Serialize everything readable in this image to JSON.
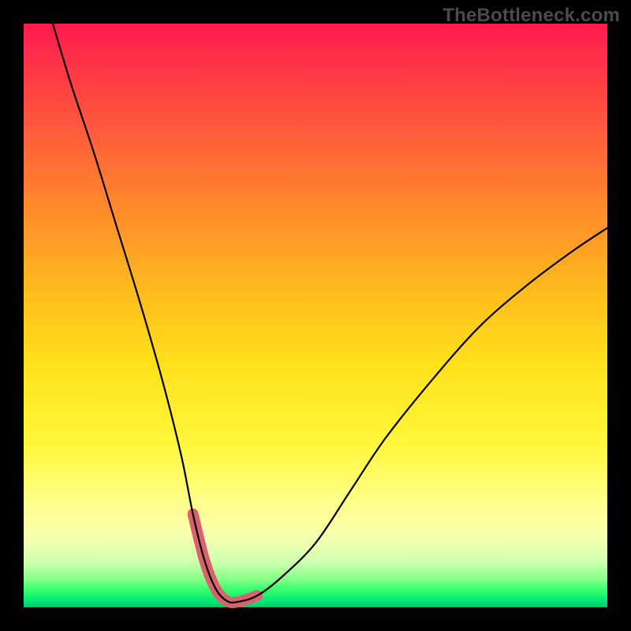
{
  "watermark": "TheBottleneck.com",
  "colors": {
    "frame_bg": "#000000",
    "gradient_top": "#ff1a4d",
    "gradient_bottom": "#00c866",
    "curve_stroke": "#000000",
    "highlight_stroke": "#d8626e"
  },
  "chart_data": {
    "type": "line",
    "title": "",
    "xlabel": "",
    "ylabel": "",
    "xlim": [
      0,
      100
    ],
    "ylim": [
      0,
      100
    ],
    "grid": false,
    "note": "Bottleneck curve: y axis is bottleneck percentage (0 at bottom / green, 100 at top / red); x axis is relative component balance. Values estimated from pixel positions; no numeric tick labels are rendered in the image.",
    "series": [
      {
        "name": "bottleneck_curve",
        "x": [
          5,
          8,
          12,
          16,
          20,
          24,
          27,
          29,
          31,
          33,
          35,
          37,
          40,
          44,
          50,
          56,
          62,
          70,
          78,
          86,
          94,
          100
        ],
        "y": [
          100,
          90,
          78,
          65,
          52,
          38,
          26,
          16,
          8,
          3,
          1,
          1,
          2,
          5,
          11,
          20,
          29,
          39,
          48,
          55,
          61,
          65
        ]
      }
    ],
    "highlight_region": {
      "description": "Pink rounded segment marking near-zero-bottleneck zone along the curve trough",
      "x_start": 29,
      "x_end": 40,
      "y_approx": 2
    }
  }
}
